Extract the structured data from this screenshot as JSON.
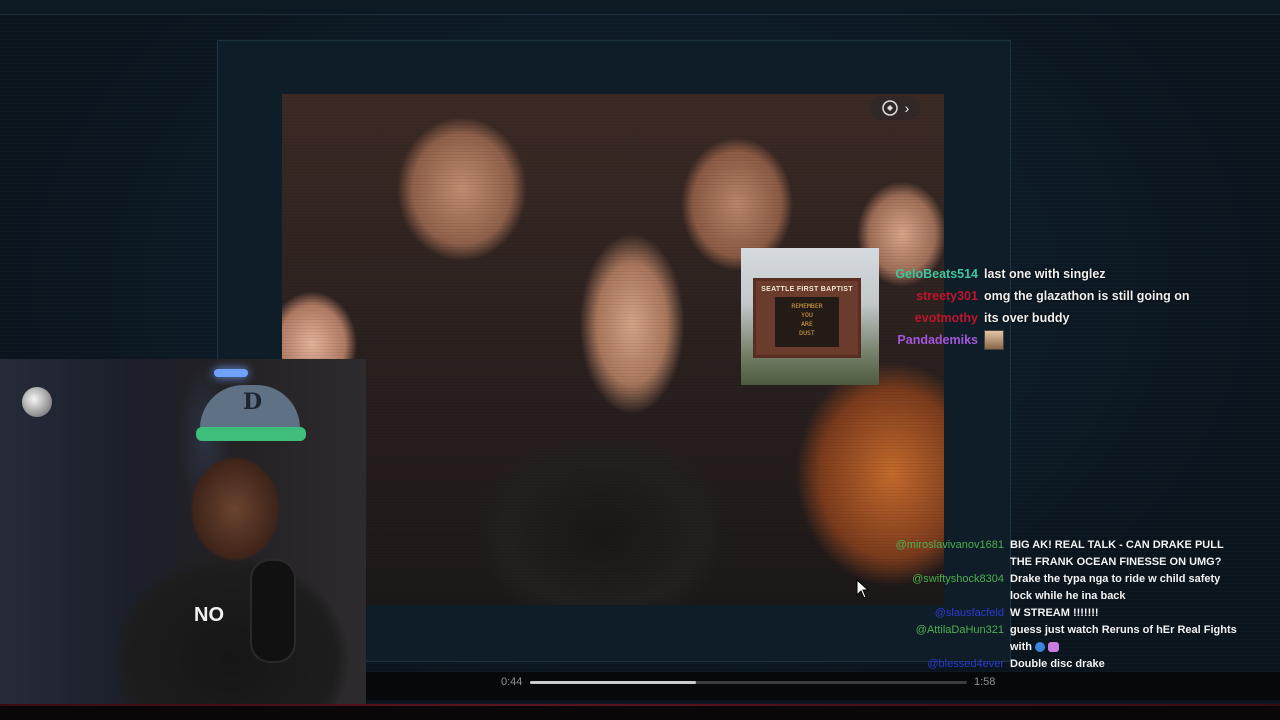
{
  "chat_top": [
    {
      "user": "GeloBeats514",
      "color": "#3ec7a0",
      "message": "last one with singlez"
    },
    {
      "user": "streety301",
      "color": "#c0142c",
      "message": "omg the glazathon is still going on"
    },
    {
      "user": "evotmothy",
      "color": "#c0142c",
      "message": "its over buddy"
    },
    {
      "user": "Pandademiks",
      "color": "#a257d8",
      "message": "",
      "emote": "face-emote"
    }
  ],
  "chat_bottom": [
    {
      "user": "@miroslavivanov1681",
      "color": "#4caf50",
      "message": "BIG AK! REAL TALK - CAN DRAKE PULL THE FRANK OCEAN FINESSE ON UMG?"
    },
    {
      "user": "@swiftyshock8304",
      "color": "#4caf50",
      "message": "Drake the typa nga to ride w child safety lock while he ina back"
    },
    {
      "user": "@slausfacfeld",
      "color": "#2a3bd0",
      "message": "W STREAM !!!!!!!"
    },
    {
      "user": "@AttilaDaHun321",
      "color": "#4caf50",
      "message": "guess just watch Reruns of hEr Real Fights with",
      "emotes": [
        "blue-circle-emote",
        "mask-emote"
      ]
    },
    {
      "user": "@blessed4ever",
      "color": "#2a3bd0",
      "message": "Double disc drake"
    }
  ],
  "player": {
    "current_time": "0:44",
    "duration": "1:58",
    "progress": 0.38
  },
  "sign": {
    "header": "SEATTLE FIRST BAPTIST",
    "line1": "REMEMBER",
    "line2": "YOU",
    "line3": "ARE",
    "line4": "DUST"
  },
  "webcam": {
    "shirt_text": "NO",
    "cap_logo": "D"
  }
}
